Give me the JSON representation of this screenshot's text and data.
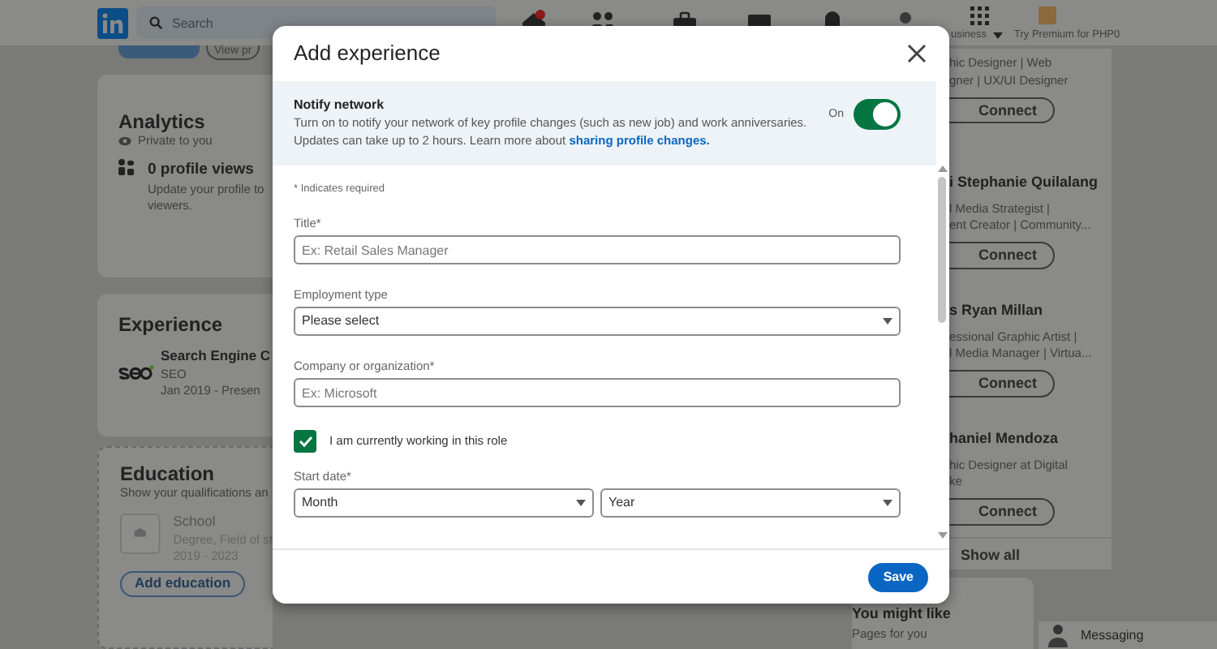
{
  "nav": {
    "search": {
      "placeholder": "Search"
    },
    "business": "usiness",
    "premium": "Try Premium for PHP0"
  },
  "left": {
    "view_button": "View pr",
    "analytics": {
      "title": "Analytics",
      "privacy": "Private to you",
      "views": "0 profile views",
      "hint_lines": [
        "Update your profile to",
        "viewers."
      ]
    },
    "experience": {
      "title": "Experience",
      "items": [
        {
          "role": "Search Engine C",
          "company": "SEO",
          "dates": "Jan 2019 - Presen"
        }
      ]
    },
    "education": {
      "title": "Education",
      "subtitle": "Show your qualifications an",
      "school": "School",
      "degree": "Degree, Field of st",
      "years": "2019 - 2023",
      "button": "Add education"
    }
  },
  "modal": {
    "title": "Add experience",
    "notify": {
      "title": "Notify network",
      "text": "Turn on to notify your network of key profile changes (such as new job) and work anniversaries.",
      "text2": "Updates can take up to 2 hours. Learn more about",
      "link": "sharing profile changes.",
      "state_label": "On",
      "on": true
    },
    "required_note": "* Indicates required",
    "fields": [
      {
        "kind": "input",
        "label": "Title*",
        "placeholder": "Ex: Retail Sales Manager"
      },
      {
        "kind": "select",
        "label": "Employment type",
        "value": "Please select"
      },
      {
        "kind": "input",
        "label": "Company or organization*",
        "placeholder": "Ex: Microsoft"
      },
      {
        "kind": "checkbox",
        "label": "I am currently working in this role",
        "checked": true
      },
      {
        "kind": "date",
        "label": "Start date*",
        "selects": [
          "Month",
          "Year"
        ]
      }
    ],
    "save": "Save"
  },
  "right": {
    "people": [
      {
        "lines": [
          "hic Designer | Web",
          "gner | UX/UI Designer"
        ],
        "button": "Connect"
      },
      {
        "name": "i Stephanie Quilalang",
        "lines": [
          "l Media Strategist |",
          "ent Creator | Community..."
        ],
        "button": "Connect"
      },
      {
        "name": "s Ryan Millan",
        "lines": [
          "essional Graphic Artist |",
          "l Media Manager | Virtua..."
        ],
        "button": "Connect"
      },
      {
        "name": "haniel Mendoza",
        "lines": [
          "hic Designer at Digital",
          "ke"
        ],
        "button": "Connect"
      }
    ],
    "show_all": "Show all",
    "you_might_like": "You might like",
    "pages_for_you": "Pages for you"
  },
  "messaging": "Messaging"
}
